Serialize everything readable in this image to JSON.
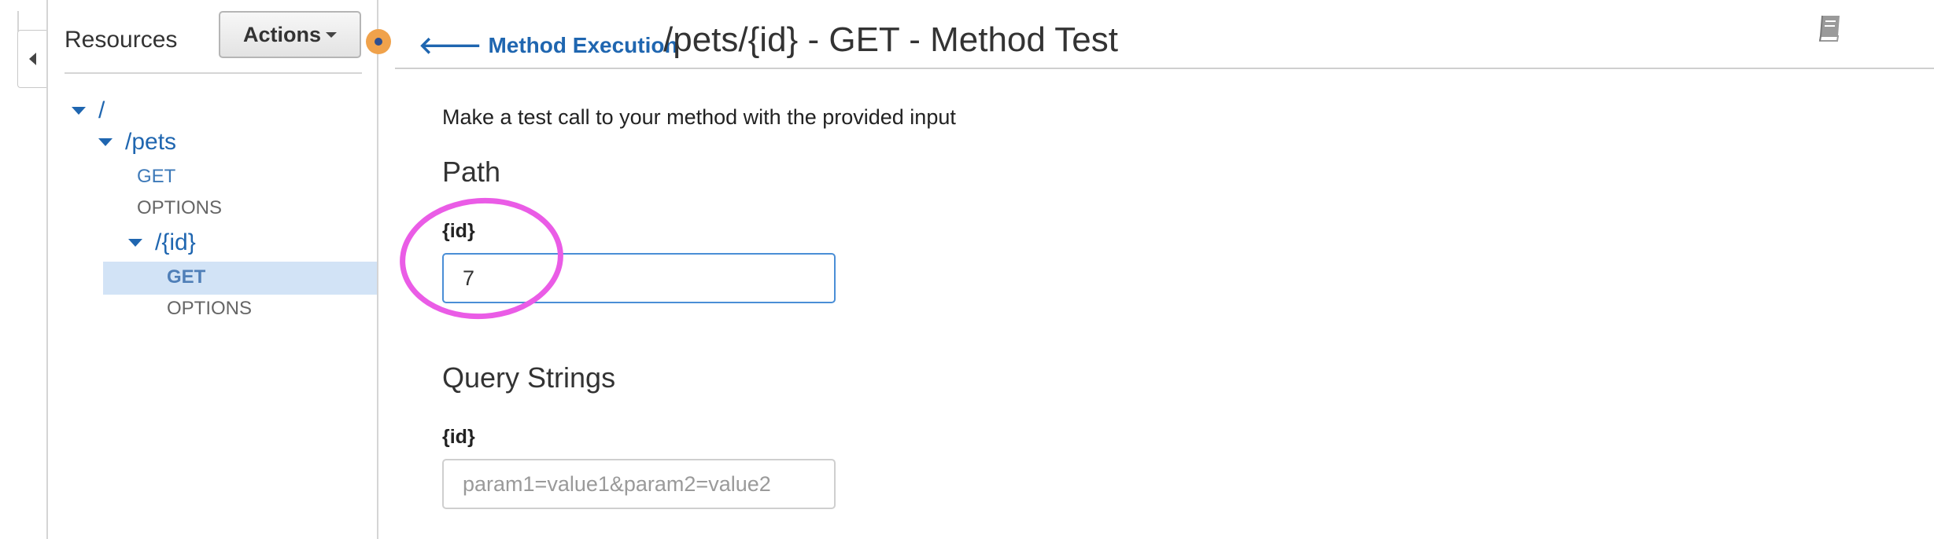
{
  "sidebar": {
    "title": "Resources",
    "actions_label": "Actions",
    "tree": {
      "root": "/",
      "pets": "/pets",
      "pets_get": "GET",
      "pets_options": "OPTIONS",
      "id": "/{id}",
      "id_get": "GET",
      "id_options": "OPTIONS"
    }
  },
  "header": {
    "back_link": "Method Execution",
    "title": "/pets/{id} - GET - Method Test"
  },
  "main": {
    "intro": "Make a test call to your method with the provided input",
    "path_section": {
      "title": "Path",
      "param_label": "{id}",
      "param_value": "7"
    },
    "query_section": {
      "title": "Query Strings",
      "param_label": "{id}",
      "placeholder": "param1=value1&param2=value2"
    }
  },
  "icons": {
    "back": "arrow-left-icon",
    "collapse": "chevron-left-icon",
    "book": "book-icon",
    "notification": "notification-dot-icon"
  },
  "colors": {
    "link_blue": "#1f66b0",
    "selected_bg": "#d2e3f6",
    "annotation_circle": "#ea5ce6",
    "notification": "#f0a24b"
  }
}
